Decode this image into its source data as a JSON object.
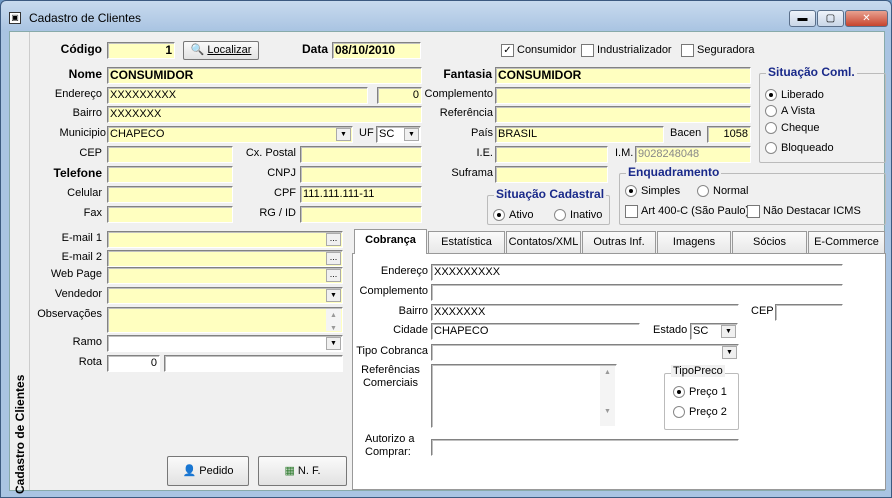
{
  "window": {
    "title": "Cadastro de Clientes",
    "side_title": "Cadastro de Clientes"
  },
  "top": {
    "codigo_label": "Código",
    "codigo": "1",
    "localizar": "Localizar",
    "data_label": "Data",
    "data": "08/10/2010",
    "checks": [
      {
        "label": "Consumidor",
        "checked": true
      },
      {
        "label": "Industrializador",
        "checked": false
      },
      {
        "label": "Seguradora",
        "checked": false
      }
    ]
  },
  "left": {
    "nome_label": "Nome",
    "nome": "CONSUMIDOR",
    "endereco_label": "Endereço",
    "endereco": "XXXXXXXXX",
    "numero": "0",
    "bairro_label": "Bairro",
    "bairro": "XXXXXXX",
    "municipio_label": "Municipio",
    "municipio": "CHAPECO",
    "uf_label": "UF",
    "uf": "SC",
    "cep_label": "CEP",
    "cxpostal_label": "Cx. Postal",
    "telefone_label": "Telefone",
    "cnpj_label": "CNPJ",
    "celular_label": "Celular",
    "cpf_label": "CPF",
    "cpf": "111.111.111-11",
    "fax_label": "Fax",
    "rg_label": "RG / ID"
  },
  "right": {
    "fantasia_label": "Fantasia",
    "fantasia": "CONSUMIDOR",
    "complemento_label": "Complemento",
    "referencia_label": "Referência",
    "pais_label": "País",
    "pais": "BRASIL",
    "bacen_label": "Bacen",
    "bacen": "1058",
    "ie_label": "I.E.",
    "im_label": "I.M.",
    "im": "9028248048",
    "suframa_label": "Suframa"
  },
  "situacao_coml": {
    "title": "Situação Coml.",
    "options": [
      "Liberado",
      "A Vista",
      "Cheque",
      "Bloqueado"
    ],
    "selected": 0
  },
  "enquadramento": {
    "title": "Enquadramento",
    "simples": "Simples",
    "normal": "Normal",
    "art": "Art 400-C (São Paulo)",
    "nao_destacar": "Não Destacar ICMS"
  },
  "situacao_cad": {
    "title": "Situação Cadastral",
    "ativo": "Ativo",
    "inativo": "Inativo"
  },
  "lower": {
    "email1": "E-mail 1",
    "email2": "E-mail 2",
    "webpage": "Web Page",
    "vendedor": "Vendedor",
    "observacoes": "Observações",
    "ramo": "Ramo",
    "rota": "Rota",
    "rota_value": "0",
    "pedido": "Pedido",
    "nf": "N. F."
  },
  "tabs": [
    "Cobrança",
    "Estatística",
    "Contatos/XML",
    "Outras Inf.",
    "Imagens",
    "Sócios",
    "E-Commerce"
  ],
  "cobranca": {
    "endereco_label": "Endereço",
    "endereco": "XXXXXXXXX",
    "complemento_label": "Complemento",
    "bairro_label": "Bairro",
    "bairro": "XXXXXXX",
    "cep_label": "CEP",
    "cidade_label": "Cidade",
    "cidade": "CHAPECO",
    "estado_label": "Estado",
    "estado": "SC",
    "tipo_cobranca_label": "Tipo Cobranca",
    "referencias_label": "Referências Comerciais",
    "tipopreco_title": "TipoPreco",
    "preco1": "Preço 1",
    "preco2": "Preço 2",
    "autorizo_label": "Autorizo a Comprar:"
  }
}
